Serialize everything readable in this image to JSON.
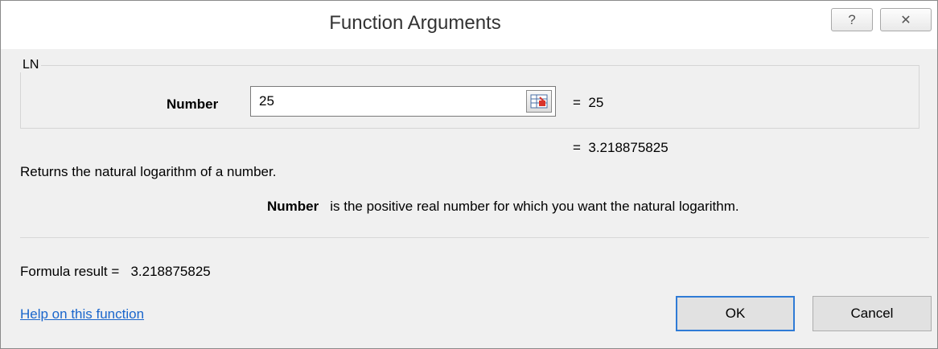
{
  "window": {
    "title": "Function Arguments",
    "help_glyph": "?",
    "close_glyph": "✕"
  },
  "function_group": {
    "name": "LN",
    "argument": {
      "label": "Number",
      "value": "25",
      "evaluated": "=  25"
    },
    "result_preview": "=  3.218875825"
  },
  "description": "Returns the natural logarithm of a number.",
  "argument_help": {
    "name": "Number",
    "text": "is the positive real number for which you want the natural logarithm."
  },
  "formula_result": "Formula result =   3.218875825",
  "help_link": "Help on this function",
  "buttons": {
    "ok": "OK",
    "cancel": "Cancel"
  },
  "icons": {
    "help": "question-mark-icon",
    "close": "close-icon",
    "picker": "range-collapse-icon"
  },
  "colors": {
    "link": "#1a66cc",
    "default_button_border": "#2f7bd6"
  }
}
